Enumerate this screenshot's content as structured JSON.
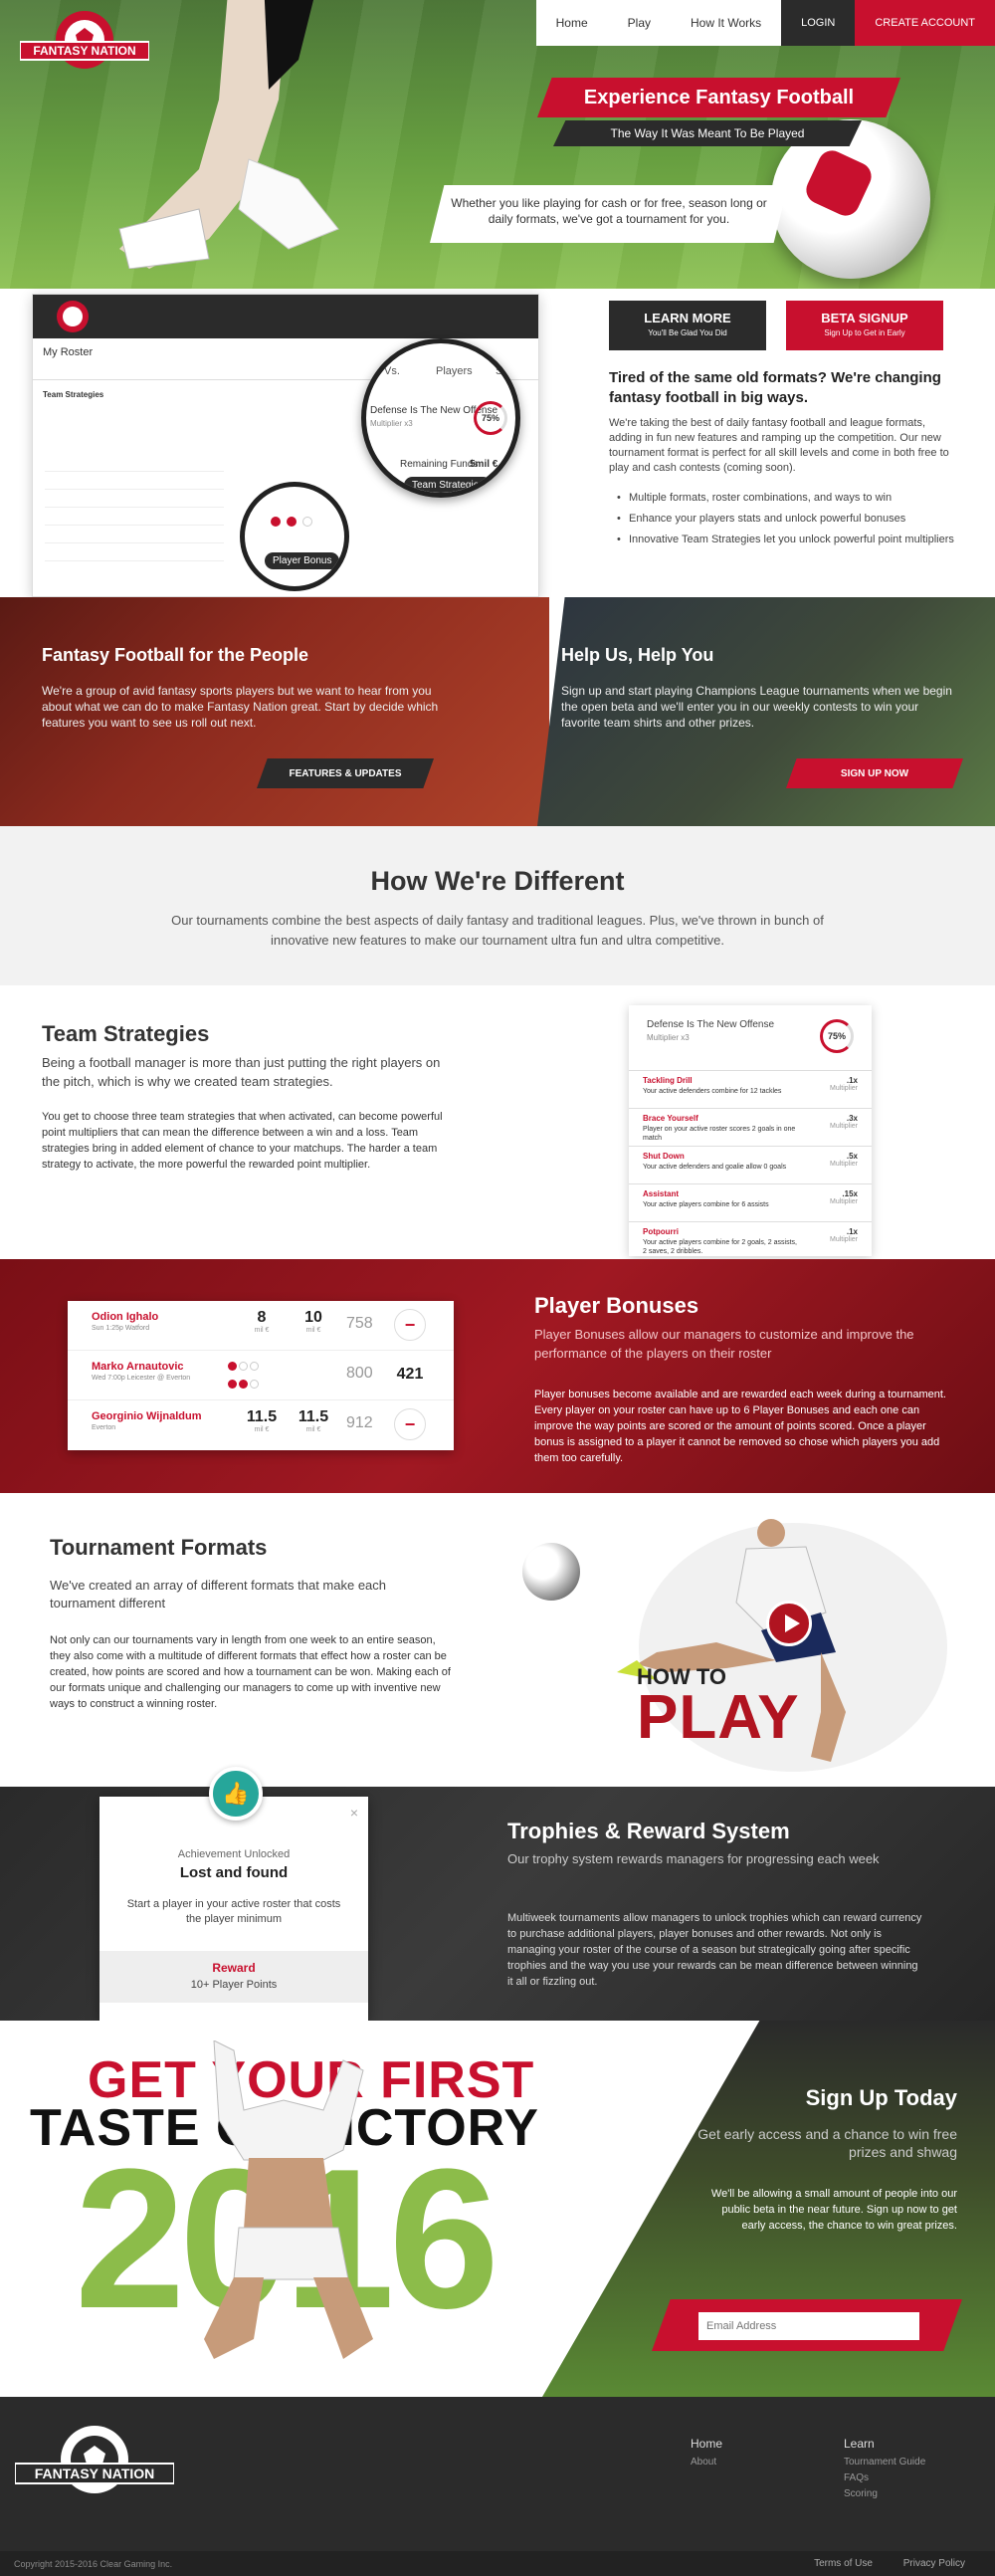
{
  "nav": {
    "items": [
      "Home",
      "Play",
      "How It Works"
    ],
    "login": "LOGIN",
    "create": "CREATE ACCOUNT"
  },
  "brand": {
    "name": "FANTASY NATION",
    "accent": "#c8102e",
    "dark": "#2b2b2b"
  },
  "hero": {
    "title": "Experience Fantasy Football",
    "subtitle": "The Way It Was Meant To Be Played",
    "text": "Whether you like playing for cash or for free, season long or daily formats, we've got a tournament for you."
  },
  "mockup": {
    "zoom_tabs": [
      "Vs.",
      "Players",
      "Sco"
    ],
    "strategy": "Defense Is The New Offense",
    "multiplier": "Multiplier x3",
    "percent": "75%",
    "remaining": "Remaining Funds",
    "remaining_value": "5mil €",
    "team_strategies": "Team Strategies",
    "player_bonus": "Player Bonus",
    "my_roster": "My Roster"
  },
  "intro": {
    "learn_more": "LEARN MORE",
    "learn_more_sub": "You'll Be Glad You Did",
    "beta": "BETA SIGNUP",
    "beta_sub": "Sign Up to Get in Early",
    "heading": "Tired of the same old formats? We're changing fantasy football in big ways.",
    "paragraph": "We're taking the best of daily fantasy football and league formats, adding in fun new features and ramping up the competition. Our new tournament format is perfect for all skill levels and come in both free to play and cash contests (coming soon).",
    "bullets": [
      "Multiple formats, roster combinations, and ways to win",
      "Enhance your players stats and unlock powerful bonuses",
      "Innovative Team Strategies let you unlock powerful point multipliers"
    ]
  },
  "people": {
    "title": "Fantasy Football for the People",
    "text": "We're a group of avid fantasy sports players but we want to hear from you about what we can do to make Fantasy Nation great. Start by decide which features you want to see us roll out next.",
    "button": "FEATURES & UPDATES"
  },
  "help": {
    "title": "Help Us, Help You",
    "text": "Sign up and start playing Champions League tournaments when we begin the open beta and we'll enter you in our weekly contests to win your favorite team shirts and other prizes.",
    "button": "SIGN UP NOW"
  },
  "different": {
    "title": "How We're Different",
    "text": "Our tournaments combine the best aspects of daily fantasy and traditional leagues. Plus, we've thrown in bunch of innovative new features to make our tournament ultra fun and ultra competitive."
  },
  "team_strategies": {
    "title": "Team Strategies",
    "lead": "Being a football manager is more than just putting the right players on the pitch, which is why we created team strategies.",
    "body": "You get to choose three team strategies that when activated, can become powerful point multipliers that can mean the difference between a win and a loss. Team strategies bring in added element of chance to your matchups. The harder a team strategy to activate, the more powerful the rewarded point multiplier.",
    "card_title": "Defense Is The New Offense",
    "card_sub": "Multiplier x3",
    "card_percent": "75%",
    "items": [
      {
        "name": "Tackling Drill",
        "desc": "Your active defenders combine for 12 tackles",
        "mult": ".1x",
        "label": "Multiplier"
      },
      {
        "name": "Brace Yourself",
        "desc": "Player on your active roster scores 2 goals in one match",
        "mult": ".3x",
        "label": "Multiplier"
      },
      {
        "name": "Shut Down",
        "desc": "Your active defenders and goalie allow 0 goals",
        "mult": ".5x",
        "label": "Multiplier"
      },
      {
        "name": "Assistant",
        "desc": "Your active players combine for 6 assists",
        "mult": ".15x",
        "label": "Multiplier"
      },
      {
        "name": "Potpourri",
        "desc": "Your active players combine for 2 goals, 2 assists, 2 saves, 2 dribbles.",
        "mult": ".1x",
        "label": "Multiplier"
      }
    ]
  },
  "player_bonuses": {
    "title": "Player Bonuses",
    "lead": "Player Bonuses allow our managers to customize and improve the performance of the players on their roster",
    "body": "Player bonuses become available and are rewarded each week during a tournament. Every player on your roster can have up to 6 Player Bonuses and each one can improve the way points are scored or the amount of points scored. Once a player bonus is assigned to a player it cannot be removed so chose which players you add them too carefully.",
    "rows": [
      {
        "name": "Odion Ighalo",
        "sub": "Sun 1:25p Watford",
        "v1": "8",
        "v2": "10",
        "unit": "mil €",
        "v3": "758",
        "v4": "−"
      },
      {
        "name": "Marko Arnautovic",
        "sub": "Wed 7:00p Leicester @ Everton",
        "v1": "",
        "v2": "",
        "unit": "",
        "v3": "800",
        "v4": "421"
      },
      {
        "name": "Georginio Wijnaldum",
        "sub": "Everton",
        "v1": "11.5",
        "v2": "11.5",
        "unit": "mil €",
        "v3": "912",
        "v4": "−"
      }
    ]
  },
  "formats": {
    "title": "Tournament Formats",
    "lead": "We've created an array of different formats that make each tournament different",
    "body": "Not only can our tournaments vary in length from one week to an entire season, they also come with a multitude of different formats that effect how a roster can be created, how points are scored and how a tournament can be won. Making each of our formats unique and challenging our managers to come up with inventive new ways to construct a winning roster.",
    "how": "HOW TO",
    "play": "PLAY"
  },
  "trophies": {
    "title": "Trophies & Reward System",
    "lead": "Our trophy system rewards managers for progressing each week",
    "body": "Multiweek tournaments allow managers to unlock trophies which can reward currency to purchase additional players, player bonuses and other rewards. Not only is managing your roster of the course of a season but strategically going after specific trophies and the way you use your rewards can be mean difference between winning it all or fizzling out.",
    "ach_kicker": "Achievement Unlocked",
    "ach_title": "Lost and found",
    "ach_desc": "Start a player in your active roster that costs the player minimum",
    "reward_label": "Reward",
    "reward_value": "10+ Player Points",
    "close": "×"
  },
  "victory": {
    "line1": "GET YOUR FIRST",
    "line2": "TASTE OF VICTORY",
    "year": "2016",
    "title": "Sign Up Today",
    "lead": "Get early access and a chance to win free prizes and shwag",
    "body": "We'll be allowing a small amount of people into our public beta in the near future. Sign up now to get early access, the chance to win great prizes.",
    "email_placeholder": "Email Address"
  },
  "footer": {
    "col1_head": "Home",
    "col1": [
      "About"
    ],
    "col2_head": "Learn",
    "col2": [
      "Tournament Guide",
      "FAQs",
      "Scoring"
    ],
    "copyright": "Copyright 2015-2016 Clear Gaming Inc.",
    "terms": "Terms of Use",
    "privacy": "Privacy Policy"
  }
}
